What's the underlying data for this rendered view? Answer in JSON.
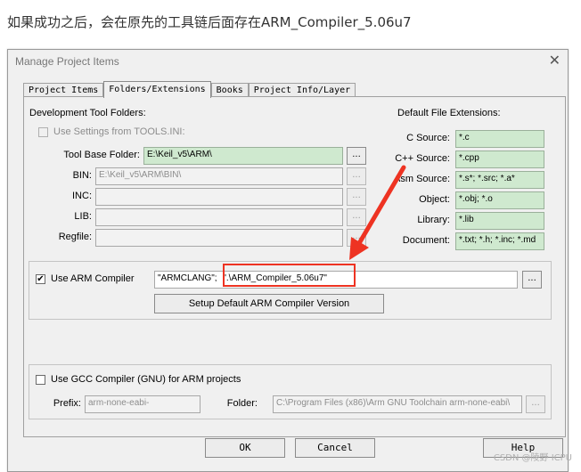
{
  "caption": "如果成功之后，会在原先的工具链后面存在ARM_Compiler_5.06u7",
  "dialog": {
    "title": "Manage Project Items",
    "close": "✕"
  },
  "tabs": [
    {
      "label": "Project Items",
      "active": false
    },
    {
      "label": "Folders/Extensions",
      "active": true
    },
    {
      "label": "Books",
      "active": false
    },
    {
      "label": "Project Info/Layer",
      "active": false
    }
  ],
  "dev_tool_folders": {
    "heading": "Development Tool Folders:",
    "use_settings_label": "Use Settings from TOOLS.INI:",
    "tool_base_label": "Tool Base Folder:",
    "tool_base_value": "E:\\Keil_v5\\ARM\\",
    "bin_label": "BIN:",
    "bin_value": "E:\\Keil_v5\\ARM\\BIN\\",
    "inc_label": "INC:",
    "inc_value": "",
    "lib_label": "LIB:",
    "lib_value": "",
    "regfile_label": "Regfile:",
    "regfile_value": "",
    "browse": "..."
  },
  "file_ext": {
    "heading": "Default File Extensions:",
    "items": [
      {
        "label": "C Source:",
        "value": "*.c"
      },
      {
        "label": "C++ Source:",
        "value": "*.cpp"
      },
      {
        "label": "Asm Source:",
        "value": "*.s*; *.src; *.a*"
      },
      {
        "label": "Object:",
        "value": "*.obj; *.o"
      },
      {
        "label": "Library:",
        "value": "*.lib"
      },
      {
        "label": "Document:",
        "value": "*.txt; *.h; *.inc; *.md"
      }
    ]
  },
  "arm_compiler": {
    "checkbox_label": "Use ARM Compiler",
    "checked": "✔",
    "value_prefix": "\"ARMCLANG\";",
    "value_highlight": "\".\\ARM_Compiler_5.06u7\"",
    "setup_button": "Setup Default ARM Compiler Version"
  },
  "gcc": {
    "checkbox_label": "Use GCC Compiler (GNU) for ARM projects",
    "prefix_label": "Prefix:",
    "prefix_value": "arm-none-eabi-",
    "folder_label": "Folder:",
    "folder_value": "C:\\Program Files (x86)\\Arm GNU Toolchain arm-none-eabi\\"
  },
  "footer": {
    "ok": "OK",
    "cancel": "Cancel",
    "help": "Help"
  },
  "watermark": "CSDN @陵野 ICPU",
  "colors": {
    "annotation": "#ee3322",
    "ext_field": "#cfe9cf"
  }
}
